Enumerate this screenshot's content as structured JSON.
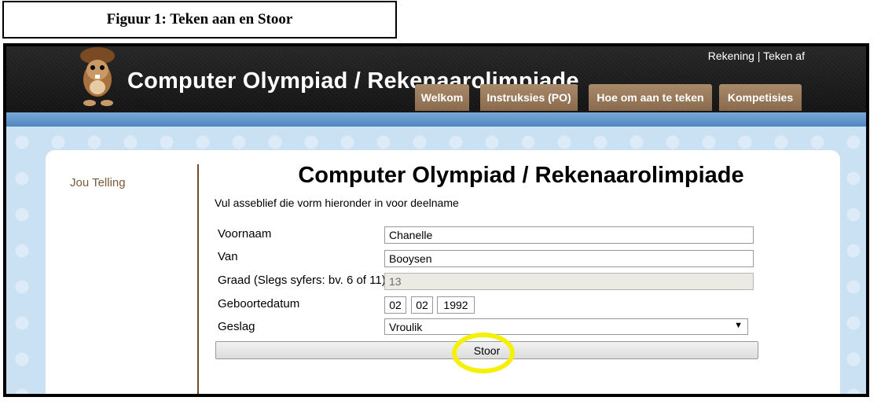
{
  "caption": "Figuur 1: Teken aan en Stoor",
  "header": {
    "site_title": "Computer Olympiad / Rekenaarolimpiade",
    "account_link": "Rekening",
    "separator": "|",
    "logout_link": "Teken af",
    "nav": [
      "Welkom",
      "Instruksies (PO)",
      "Hoe om aan te teken",
      "Kompetisies"
    ]
  },
  "sidebar": {
    "score_link": "Jou Telling"
  },
  "form": {
    "title": "Computer Olympiad / Rekenaarolimpiade",
    "intro": "Vul asseblief die vorm hieronder in voor deelname",
    "first_name_label": "Voornaam",
    "first_name_value": "Chanelle",
    "surname_label": "Van",
    "surname_value": "Booysen",
    "grade_label": "Graad (Slegs syfers: bv. 6 of 11)",
    "grade_value": "13",
    "dob_label": "Geboortedatum",
    "dob_day": "02",
    "dob_month": "02",
    "dob_year": "1992",
    "gender_label": "Geslag",
    "gender_value": "Vroulik",
    "save_button": "Stoor"
  },
  "colors": {
    "highlight": "#f5f00a",
    "nav_tab": "#9a7a5b",
    "header": "#1e1e1e",
    "stripe": "#5b8fc7"
  }
}
